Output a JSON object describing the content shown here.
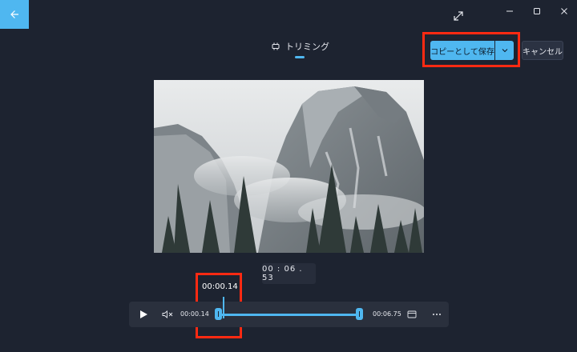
{
  "header": {
    "back_icon": "back-arrow-icon",
    "expand_icon": "expand-icon",
    "window_controls": [
      "minimize-icon",
      "maximize-icon",
      "close-icon"
    ]
  },
  "mode": {
    "label": "トリミング",
    "icon": "trim-icon"
  },
  "actions": {
    "save_label": "コピーとして保存",
    "save_dropdown_icon": "chevron-down-icon",
    "cancel_label": "キャンセル"
  },
  "player": {
    "time_display": "00 : 06 . 53",
    "playhead_label": "00:00.14",
    "start_time": "00:00.14",
    "end_time": "00:06.75",
    "play_icon": "play-icon",
    "mute_icon": "mute-icon",
    "frame_icon": "frame-icon",
    "more_icon": "more-icon"
  },
  "colors": {
    "accent": "#4fb7f0",
    "background": "#1d2330",
    "annotation": "#ff2a12"
  }
}
